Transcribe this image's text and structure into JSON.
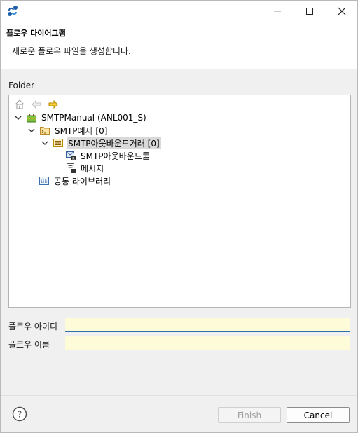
{
  "window": {
    "minimize_symbol": "—",
    "maximize_symbol": "☐",
    "close_symbol": "✕"
  },
  "header": {
    "title": "플로우 다이어그램",
    "description": "새로운 플로우 파일을 생성합니다."
  },
  "folder": {
    "label": "Folder"
  },
  "tree": {
    "items": [
      {
        "label": "SMTPManual  (ANL001_S)",
        "icon": "briefcase-icon",
        "expanded": true
      },
      {
        "label": "SMTP예제 [0]",
        "icon": "folder-icon",
        "expanded": true
      },
      {
        "label": "SMTP아웃바운드거래 [0]",
        "icon": "transaction-icon",
        "expanded": true,
        "selected": true
      },
      {
        "label": "SMTP아웃바운드룰",
        "icon": "smtp-rule-icon"
      },
      {
        "label": "메시지",
        "icon": "message-icon"
      },
      {
        "label": "공통 라이브러리",
        "icon": "library-icon"
      }
    ]
  },
  "form": {
    "flow_id_label": "플로우 아이디",
    "flow_id_value": "",
    "flow_name_label": "플로우 이름",
    "flow_name_value": ""
  },
  "footer": {
    "help_symbol": "?",
    "finish_label": "Finish",
    "cancel_label": "Cancel"
  },
  "colors": {
    "input_bg": "#fdfbd8",
    "focus_accent": "#2e6fb0",
    "selection_bg": "#d9d9d9",
    "forward_arrow": "#e8b400"
  }
}
